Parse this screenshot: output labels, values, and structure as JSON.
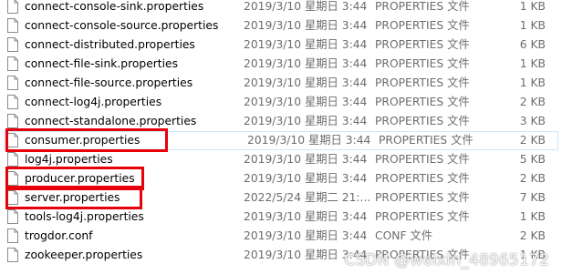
{
  "files": [
    {
      "name": "connect-console-sink.properties",
      "date": "2019/3/10 星期日 3:44",
      "type": "PROPERTIES 文件",
      "size": "1 KB"
    },
    {
      "name": "connect-console-source.properties",
      "date": "2019/3/10 星期日 3:44",
      "type": "PROPERTIES 文件",
      "size": "1 KB"
    },
    {
      "name": "connect-distributed.properties",
      "date": "2019/3/10 星期日 3:44",
      "type": "PROPERTIES 文件",
      "size": "6 KB"
    },
    {
      "name": "connect-file-sink.properties",
      "date": "2019/3/10 星期日 3:44",
      "type": "PROPERTIES 文件",
      "size": "1 KB"
    },
    {
      "name": "connect-file-source.properties",
      "date": "2019/3/10 星期日 3:44",
      "type": "PROPERTIES 文件",
      "size": "1 KB"
    },
    {
      "name": "connect-log4j.properties",
      "date": "2019/3/10 星期日 3:44",
      "type": "PROPERTIES 文件",
      "size": "2 KB"
    },
    {
      "name": "connect-standalone.properties",
      "date": "2019/3/10 星期日 3:44",
      "type": "PROPERTIES 文件",
      "size": "3 KB"
    },
    {
      "name": "consumer.properties",
      "date": "2019/3/10 星期日 3:44",
      "type": "PROPERTIES 文件",
      "size": "2 KB",
      "selected": true,
      "highlighted": true
    },
    {
      "name": "log4j.properties",
      "date": "2019/3/10 星期日 3:44",
      "type": "PROPERTIES 文件",
      "size": "5 KB"
    },
    {
      "name": "producer.properties",
      "date": "2019/3/10 星期日 3:44",
      "type": "PROPERTIES 文件",
      "size": "2 KB",
      "highlighted": true
    },
    {
      "name": "server.properties",
      "date": "2022/5/24 星期二 21:...",
      "type": "PROPERTIES 文件",
      "size": "7 KB",
      "highlighted": true
    },
    {
      "name": "tools-log4j.properties",
      "date": "2019/3/10 星期日 3:44",
      "type": "PROPERTIES 文件",
      "size": "1 KB"
    },
    {
      "name": "trogdor.conf",
      "date": "2019/3/10 星期日 3:44",
      "type": "CONF 文件",
      "size": "2 KB"
    },
    {
      "name": "zookeeper.properties",
      "date": "2019/3/10 星期日 3:44",
      "type": "PROPERTIES 文件",
      "size": "1 KB"
    }
  ],
  "icon": "file-icon",
  "highlight_color": "#e8000b",
  "selection_color": "#cde8ff",
  "watermark": "CSDN @weixin_48965172"
}
